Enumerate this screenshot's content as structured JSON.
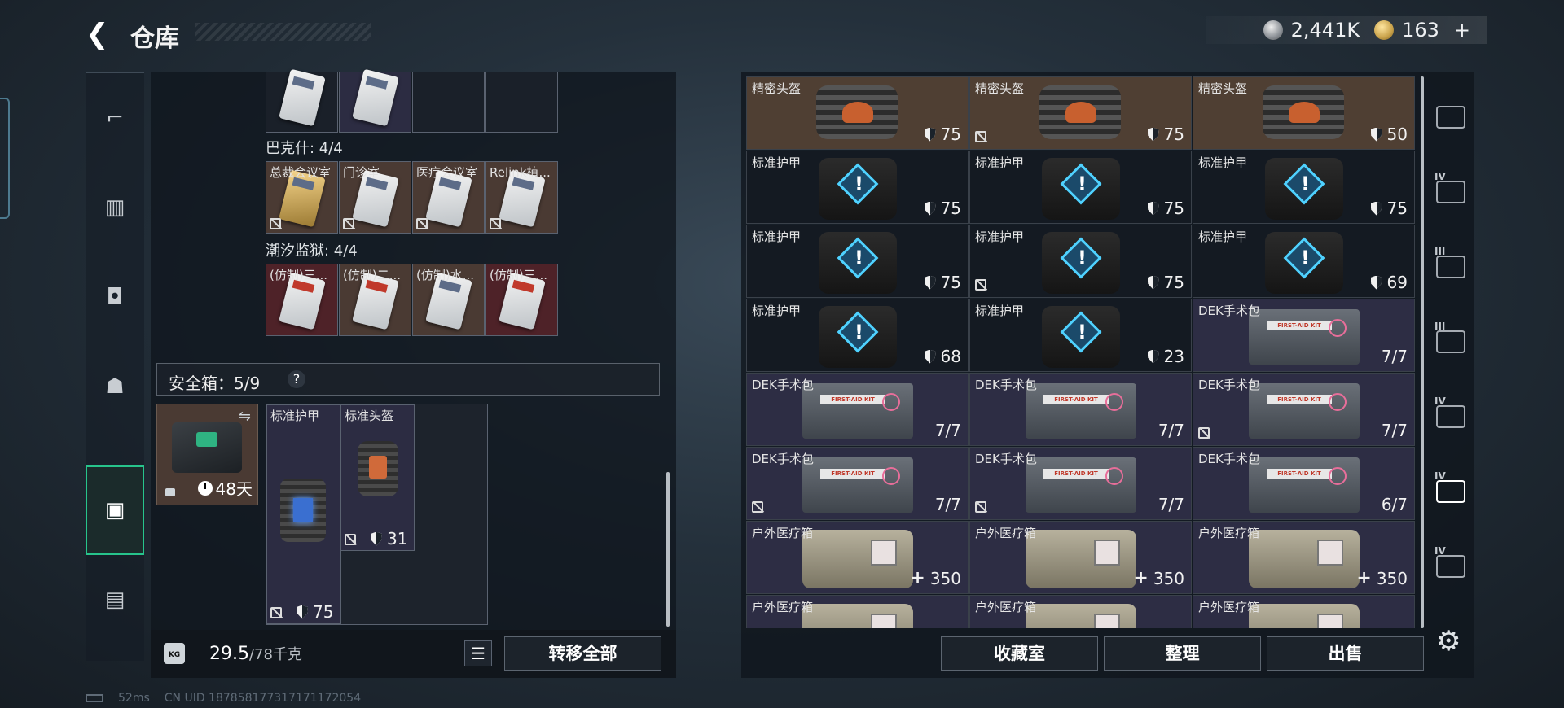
{
  "header": {
    "back_icon": "back-arrow-icon",
    "title": "仓库"
  },
  "currency": {
    "silver": "2,441K",
    "gold": "163",
    "plus": "+"
  },
  "left_nav": [
    "gun-icon",
    "vest-icon",
    "backpack-icon",
    "bag-icon",
    "safe-box-icon",
    "briefcase-icon"
  ],
  "left_panel": {
    "groups": [
      {
        "title": "巴克什: 4/4",
        "items": [
          "总裁会议室",
          "门诊室",
          "医疗会议室",
          "Relink植..."
        ]
      },
      {
        "title": "潮汐监狱: 4/4",
        "items": [
          "(仿制)三...",
          "(仿制)二...",
          "(仿制)水...",
          "(仿制)三..."
        ]
      }
    ],
    "safe": {
      "label": "安全箱：5/9",
      "help": "?",
      "time": "48天"
    },
    "safe_items": [
      {
        "name": "标准护甲",
        "value": "75"
      },
      {
        "name": "标准头盔",
        "value": "31"
      }
    ],
    "capacity": {
      "current": "29.5",
      "max": "/78千克"
    },
    "transfer_all": "转移全部",
    "kg": "KG"
  },
  "right_grid": [
    [
      {
        "name": "精密头盔",
        "value": "75",
        "kind": "helmet",
        "bg": "brown",
        "lock": false
      },
      {
        "name": "精密头盔",
        "value": "75",
        "kind": "helmet",
        "bg": "brown",
        "lock": true
      },
      {
        "name": "精密头盔",
        "value": "50",
        "kind": "helmet",
        "bg": "brown",
        "lock": false
      }
    ],
    [
      {
        "name": "标准护甲",
        "value": "75",
        "kind": "armor",
        "bg": "dark",
        "lock": false
      },
      {
        "name": "标准护甲",
        "value": "75",
        "kind": "armor",
        "bg": "dark",
        "lock": false
      },
      {
        "name": "标准护甲",
        "value": "75",
        "kind": "armor",
        "bg": "dark",
        "lock": false
      }
    ],
    [
      {
        "name": "标准护甲",
        "value": "75",
        "kind": "armor",
        "bg": "dark",
        "lock": false
      },
      {
        "name": "标准护甲",
        "value": "75",
        "kind": "armor",
        "bg": "dark",
        "lock": true
      },
      {
        "name": "标准护甲",
        "value": "69",
        "kind": "armor",
        "bg": "dark",
        "lock": false
      }
    ],
    [
      {
        "name": "标准护甲",
        "value": "68",
        "kind": "armor",
        "bg": "dark",
        "lock": false
      },
      {
        "name": "标准护甲",
        "value": "23",
        "kind": "armor",
        "bg": "dark",
        "lock": false
      },
      {
        "name": "DEK手术包",
        "value": "7/7",
        "kind": "kit",
        "bg": "violet",
        "lock": false
      }
    ],
    [
      {
        "name": "DEK手术包",
        "value": "7/7",
        "kind": "kit",
        "bg": "violet",
        "lock": false
      },
      {
        "name": "DEK手术包",
        "value": "7/7",
        "kind": "kit",
        "bg": "violet",
        "lock": false
      },
      {
        "name": "DEK手术包",
        "value": "7/7",
        "kind": "kit",
        "bg": "violet",
        "lock": true
      }
    ],
    [
      {
        "name": "DEK手术包",
        "value": "7/7",
        "kind": "kit",
        "bg": "violet",
        "lock": true
      },
      {
        "name": "DEK手术包",
        "value": "7/7",
        "kind": "kit",
        "bg": "violet",
        "lock": true
      },
      {
        "name": "DEK手术包",
        "value": "6/7",
        "kind": "kit",
        "bg": "violet",
        "lock": false
      }
    ],
    [
      {
        "name": "户外医疗箱",
        "value": "350",
        "kind": "medkit",
        "bg": "violet",
        "lock": false
      },
      {
        "name": "户外医疗箱",
        "value": "350",
        "kind": "medkit",
        "bg": "violet",
        "lock": false
      },
      {
        "name": "户外医疗箱",
        "value": "350",
        "kind": "medkit",
        "bg": "violet",
        "lock": false
      }
    ],
    [
      {
        "name": "户外医疗箱",
        "value": "",
        "kind": "medkit",
        "bg": "violet",
        "lock": false
      },
      {
        "name": "户外医疗箱",
        "value": "",
        "kind": "medkit",
        "bg": "violet",
        "lock": false
      },
      {
        "name": "户外医疗箱",
        "value": "",
        "kind": "medkit",
        "bg": "violet",
        "lock": false
      }
    ]
  ],
  "right_buttons": {
    "collection": "收藏室",
    "sort": "整理",
    "sell": "出售"
  },
  "right_tabs": [
    {
      "icon": "helmet-tab-icon",
      "tier": ""
    },
    {
      "icon": "vest-tier-icon",
      "tier": "IV"
    },
    {
      "icon": "warning-tier-icon",
      "tier": "III"
    },
    {
      "icon": "gun-tier-icon",
      "tier": "III"
    },
    {
      "icon": "folder-tier-icon",
      "tier": "IV"
    },
    {
      "icon": "medkit-tier-icon",
      "tier": "IV"
    },
    {
      "icon": "chip-tier-icon",
      "tier": "IV"
    }
  ],
  "status": {
    "ping": "52ms",
    "uid": "CN UID 1878581773171711720​54"
  }
}
